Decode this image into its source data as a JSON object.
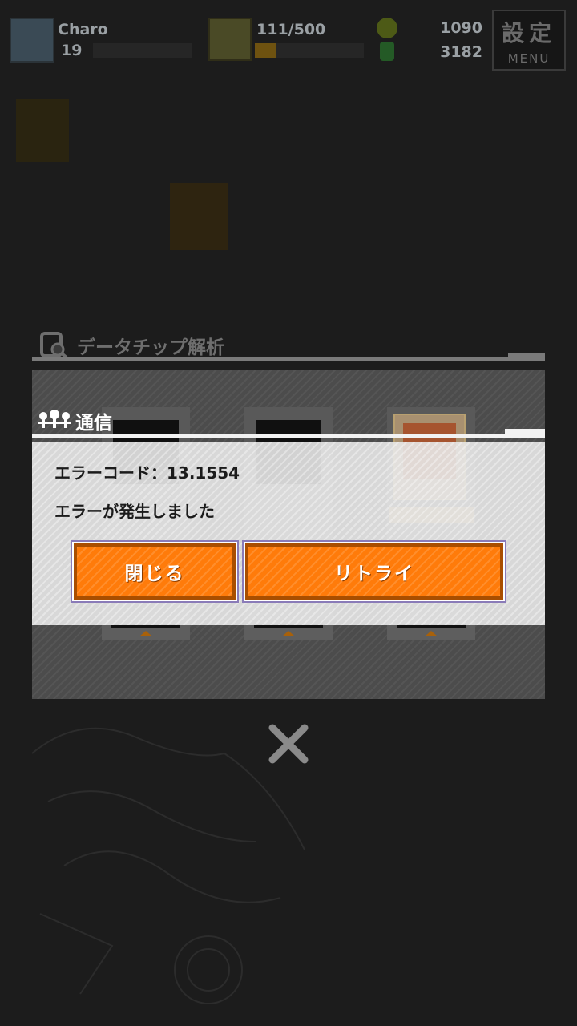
{
  "header": {
    "player_name": "Charo",
    "player_level": "19",
    "stamina": "111/500",
    "stamina_fraction": 0.2,
    "coins": "1090",
    "gems": "3182",
    "menu_kanji": "設定",
    "menu_label": "MENU"
  },
  "analysis_panel": {
    "title": "データチップ解析"
  },
  "dialog": {
    "title": "通信",
    "error_code": "エラーコード：13.1554",
    "message": "エラーが発生しました",
    "close_label": "閉じる",
    "retry_label": "リトライ"
  },
  "icons": {
    "close": "close-x-icon",
    "communication": "antenna-icon",
    "analysis": "chip-search-icon"
  },
  "colors": {
    "button_orange": "#ff7b0a",
    "button_border": "#a94e00",
    "dialog_bg": "#e8e8e8"
  }
}
